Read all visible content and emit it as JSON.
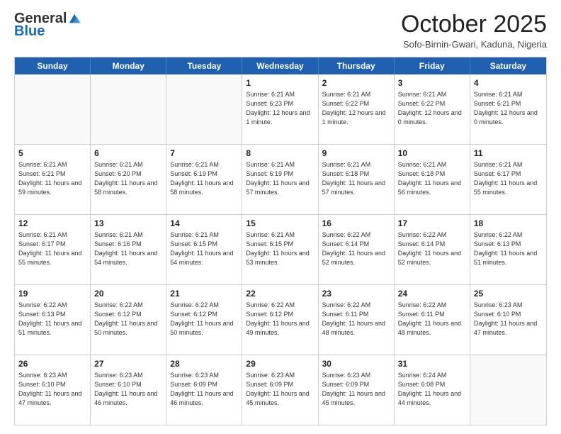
{
  "logo": {
    "general": "General",
    "blue": "Blue"
  },
  "header": {
    "month": "October 2025",
    "location": "Sofo-Birnin-Gwari, Kaduna, Nigeria"
  },
  "days": [
    "Sunday",
    "Monday",
    "Tuesday",
    "Wednesday",
    "Thursday",
    "Friday",
    "Saturday"
  ],
  "rows": [
    [
      {
        "day": "",
        "info": ""
      },
      {
        "day": "",
        "info": ""
      },
      {
        "day": "",
        "info": ""
      },
      {
        "day": "1",
        "info": "Sunrise: 6:21 AM\nSunset: 6:23 PM\nDaylight: 12 hours\nand 1 minute."
      },
      {
        "day": "2",
        "info": "Sunrise: 6:21 AM\nSunset: 6:22 PM\nDaylight: 12 hours\nand 1 minute."
      },
      {
        "day": "3",
        "info": "Sunrise: 6:21 AM\nSunset: 6:22 PM\nDaylight: 12 hours\nand 0 minutes."
      },
      {
        "day": "4",
        "info": "Sunrise: 6:21 AM\nSunset: 6:21 PM\nDaylight: 12 hours\nand 0 minutes."
      }
    ],
    [
      {
        "day": "5",
        "info": "Sunrise: 6:21 AM\nSunset: 6:21 PM\nDaylight: 11 hours\nand 59 minutes."
      },
      {
        "day": "6",
        "info": "Sunrise: 6:21 AM\nSunset: 6:20 PM\nDaylight: 11 hours\nand 58 minutes."
      },
      {
        "day": "7",
        "info": "Sunrise: 6:21 AM\nSunset: 6:19 PM\nDaylight: 11 hours\nand 58 minutes."
      },
      {
        "day": "8",
        "info": "Sunrise: 6:21 AM\nSunset: 6:19 PM\nDaylight: 11 hours\nand 57 minutes."
      },
      {
        "day": "9",
        "info": "Sunrise: 6:21 AM\nSunset: 6:18 PM\nDaylight: 11 hours\nand 57 minutes."
      },
      {
        "day": "10",
        "info": "Sunrise: 6:21 AM\nSunset: 6:18 PM\nDaylight: 11 hours\nand 56 minutes."
      },
      {
        "day": "11",
        "info": "Sunrise: 6:21 AM\nSunset: 6:17 PM\nDaylight: 11 hours\nand 55 minutes."
      }
    ],
    [
      {
        "day": "12",
        "info": "Sunrise: 6:21 AM\nSunset: 6:17 PM\nDaylight: 11 hours\nand 55 minutes."
      },
      {
        "day": "13",
        "info": "Sunrise: 6:21 AM\nSunset: 6:16 PM\nDaylight: 11 hours\nand 54 minutes."
      },
      {
        "day": "14",
        "info": "Sunrise: 6:21 AM\nSunset: 6:15 PM\nDaylight: 11 hours\nand 54 minutes."
      },
      {
        "day": "15",
        "info": "Sunrise: 6:21 AM\nSunset: 6:15 PM\nDaylight: 11 hours\nand 53 minutes."
      },
      {
        "day": "16",
        "info": "Sunrise: 6:22 AM\nSunset: 6:14 PM\nDaylight: 11 hours\nand 52 minutes."
      },
      {
        "day": "17",
        "info": "Sunrise: 6:22 AM\nSunset: 6:14 PM\nDaylight: 11 hours\nand 52 minutes."
      },
      {
        "day": "18",
        "info": "Sunrise: 6:22 AM\nSunset: 6:13 PM\nDaylight: 11 hours\nand 51 minutes."
      }
    ],
    [
      {
        "day": "19",
        "info": "Sunrise: 6:22 AM\nSunset: 6:13 PM\nDaylight: 11 hours\nand 51 minutes."
      },
      {
        "day": "20",
        "info": "Sunrise: 6:22 AM\nSunset: 6:12 PM\nDaylight: 11 hours\nand 50 minutes."
      },
      {
        "day": "21",
        "info": "Sunrise: 6:22 AM\nSunset: 6:12 PM\nDaylight: 11 hours\nand 50 minutes."
      },
      {
        "day": "22",
        "info": "Sunrise: 6:22 AM\nSunset: 6:12 PM\nDaylight: 11 hours\nand 49 minutes."
      },
      {
        "day": "23",
        "info": "Sunrise: 6:22 AM\nSunset: 6:11 PM\nDaylight: 11 hours\nand 48 minutes."
      },
      {
        "day": "24",
        "info": "Sunrise: 6:22 AM\nSunset: 6:11 PM\nDaylight: 11 hours\nand 48 minutes."
      },
      {
        "day": "25",
        "info": "Sunrise: 6:23 AM\nSunset: 6:10 PM\nDaylight: 11 hours\nand 47 minutes."
      }
    ],
    [
      {
        "day": "26",
        "info": "Sunrise: 6:23 AM\nSunset: 6:10 PM\nDaylight: 11 hours\nand 47 minutes."
      },
      {
        "day": "27",
        "info": "Sunrise: 6:23 AM\nSunset: 6:10 PM\nDaylight: 11 hours\nand 46 minutes."
      },
      {
        "day": "28",
        "info": "Sunrise: 6:23 AM\nSunset: 6:09 PM\nDaylight: 11 hours\nand 46 minutes."
      },
      {
        "day": "29",
        "info": "Sunrise: 6:23 AM\nSunset: 6:09 PM\nDaylight: 11 hours\nand 45 minutes."
      },
      {
        "day": "30",
        "info": "Sunrise: 6:23 AM\nSunset: 6:09 PM\nDaylight: 11 hours\nand 45 minutes."
      },
      {
        "day": "31",
        "info": "Sunrise: 6:24 AM\nSunset: 6:08 PM\nDaylight: 11 hours\nand 44 minutes."
      },
      {
        "day": "",
        "info": ""
      }
    ]
  ]
}
